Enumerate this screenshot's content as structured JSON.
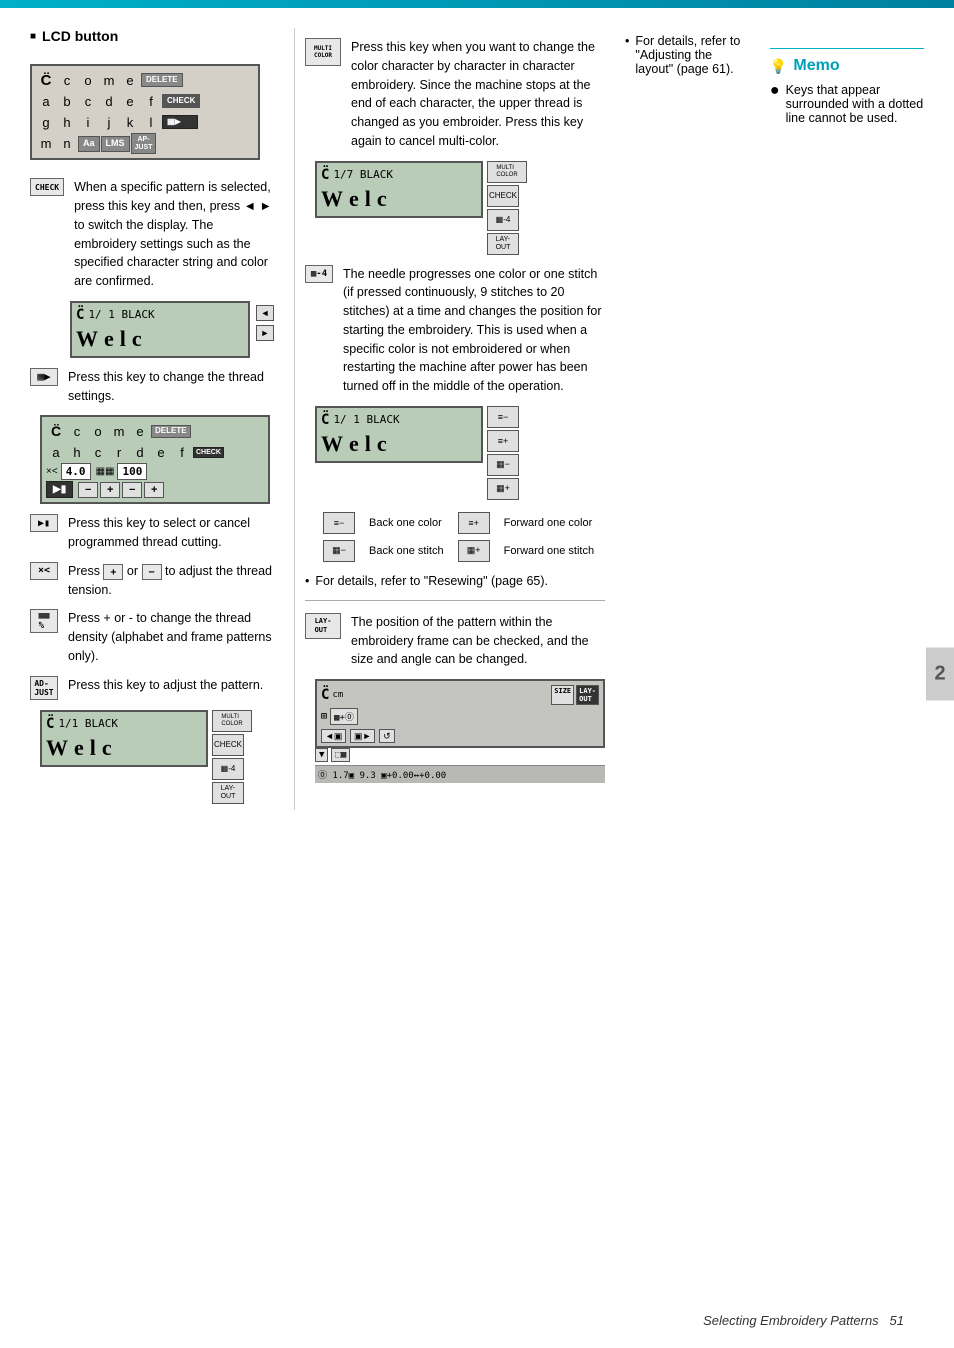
{
  "page": {
    "title": "Selecting Embroidery Patterns",
    "page_number": "51",
    "chapter_number": "2"
  },
  "left_column": {
    "section_title": "LCD button",
    "check_key": {
      "label": "CHECK",
      "description": "When a specific pattern is selected, press this key and then, press ◄ ► to switch the display. The embroidery settings such as the specified character string and color are confirmed."
    },
    "lcd_display_chars": [
      "c",
      "o",
      "m",
      "e",
      "d",
      "e",
      "l",
      "e",
      "t",
      "e"
    ],
    "lcd_rows": [
      [
        "C̈",
        "c",
        "o",
        "m",
        "e",
        "DELETE"
      ],
      [
        "a",
        "b",
        "c",
        "d",
        "e",
        "f",
        "CHECK"
      ],
      [
        "g",
        "h",
        "i",
        "j",
        "k",
        "l",
        "▦▶"
      ],
      [
        "m",
        "n",
        "Aa",
        "LMS",
        "AP-JUST"
      ]
    ],
    "preview_screen": {
      "line1": "1/ 1  BLACK",
      "chars": [
        "W",
        "e",
        "l",
        "c"
      ],
      "nav_left": "◄",
      "nav_right": "►"
    },
    "thread_key": {
      "label": "▦▶",
      "description": "Press this key to change the thread settings."
    },
    "thread_screen": {
      "chars": [
        "c",
        "o",
        "m",
        "e"
      ],
      "row2": [
        "a",
        "h",
        "c",
        "d",
        "e",
        "f"
      ],
      "row3_label1": "×<",
      "row3_val1": "4.0",
      "row3_label2": "▦▦",
      "row3_val2": "100",
      "row4": [
        "▶▮"
      ]
    },
    "thread_cut_key": {
      "label": "▶▮",
      "description": "Press this key to select or cancel programmed thread cutting."
    },
    "tension_key": {
      "label": "×<",
      "description": "Press + or - to adjust the thread tension."
    },
    "density_key": {
      "label": "▦▦%",
      "description": "Press + or - to change the thread density (alphabet and frame patterns only)."
    },
    "adjust_key": {
      "label": "AD-JUST",
      "description": "Press this key to adjust the pattern."
    },
    "adjust_screen": {
      "line1": "1/1  BLACK",
      "chars": [
        "W",
        "e",
        "l",
        "c"
      ],
      "side_buttons": [
        "MULTI COLOR",
        "CHECK",
        "▦-4",
        "LAY-OUT"
      ]
    }
  },
  "right_column": {
    "multi_color_description": "Press this key when you want to change the color character by character in character embroidery. Since the machine stops at the end of each character, the upper thread is changed as you embroider. Press this key again to cancel multi-color.",
    "multi_color_screen": {
      "line1": "1/7  BLACK",
      "chars": [
        "W",
        "e",
        "l",
        "c"
      ],
      "side_buttons": [
        "MULTI COLOR",
        "CHECK",
        "▦-4",
        "LAY-OUT"
      ]
    },
    "needle_key": {
      "label": "▦-4",
      "description": "The needle progresses one color or one stitch (if pressed continuously, 9 stitches to 20 stitches) at a time and changes the position for starting the embroidery. This is used when a specific color is not embroidered or when restarting the machine after power has been turned off in the middle of the operation."
    },
    "needle_screen": {
      "line1": "1/ 1  BLACK",
      "chars": [
        "W",
        "e",
        "l",
        "c"
      ],
      "side_buttons": [
        "≡-",
        "≡+",
        "▦-",
        "▦+"
      ]
    },
    "color_nav": {
      "back_color_label": "Back one color",
      "back_color_btn": "≡-",
      "forward_color_label": "Forward one color",
      "forward_color_btn": "≡+",
      "back_stitch_label": "Back one stitch",
      "back_stitch_btn": "▦-",
      "forward_stitch_label": "Forward one stitch",
      "forward_stitch_btn": "▦+"
    },
    "resewing_note": "For details, refer to \"Resewing\" (page 65).",
    "layout_key": {
      "label": "LAY-OUT",
      "description": "The position of the pattern within the embroidery frame can be checked, and the size and angle can be changed."
    },
    "layout_screen": {
      "top_row": "cm",
      "bottom_row": "⓪ 1.7▣  9.3  ▣+0.00↔+0.00",
      "side_buttons": [
        "SIZE",
        "LAY-OUT"
      ]
    },
    "layout_note": "For details, refer to \"Adjusting the layout\" (page 61).",
    "memo": {
      "title": "Memo",
      "items": [
        "Keys that appear surrounded with a dotted line cannot be used."
      ]
    }
  }
}
